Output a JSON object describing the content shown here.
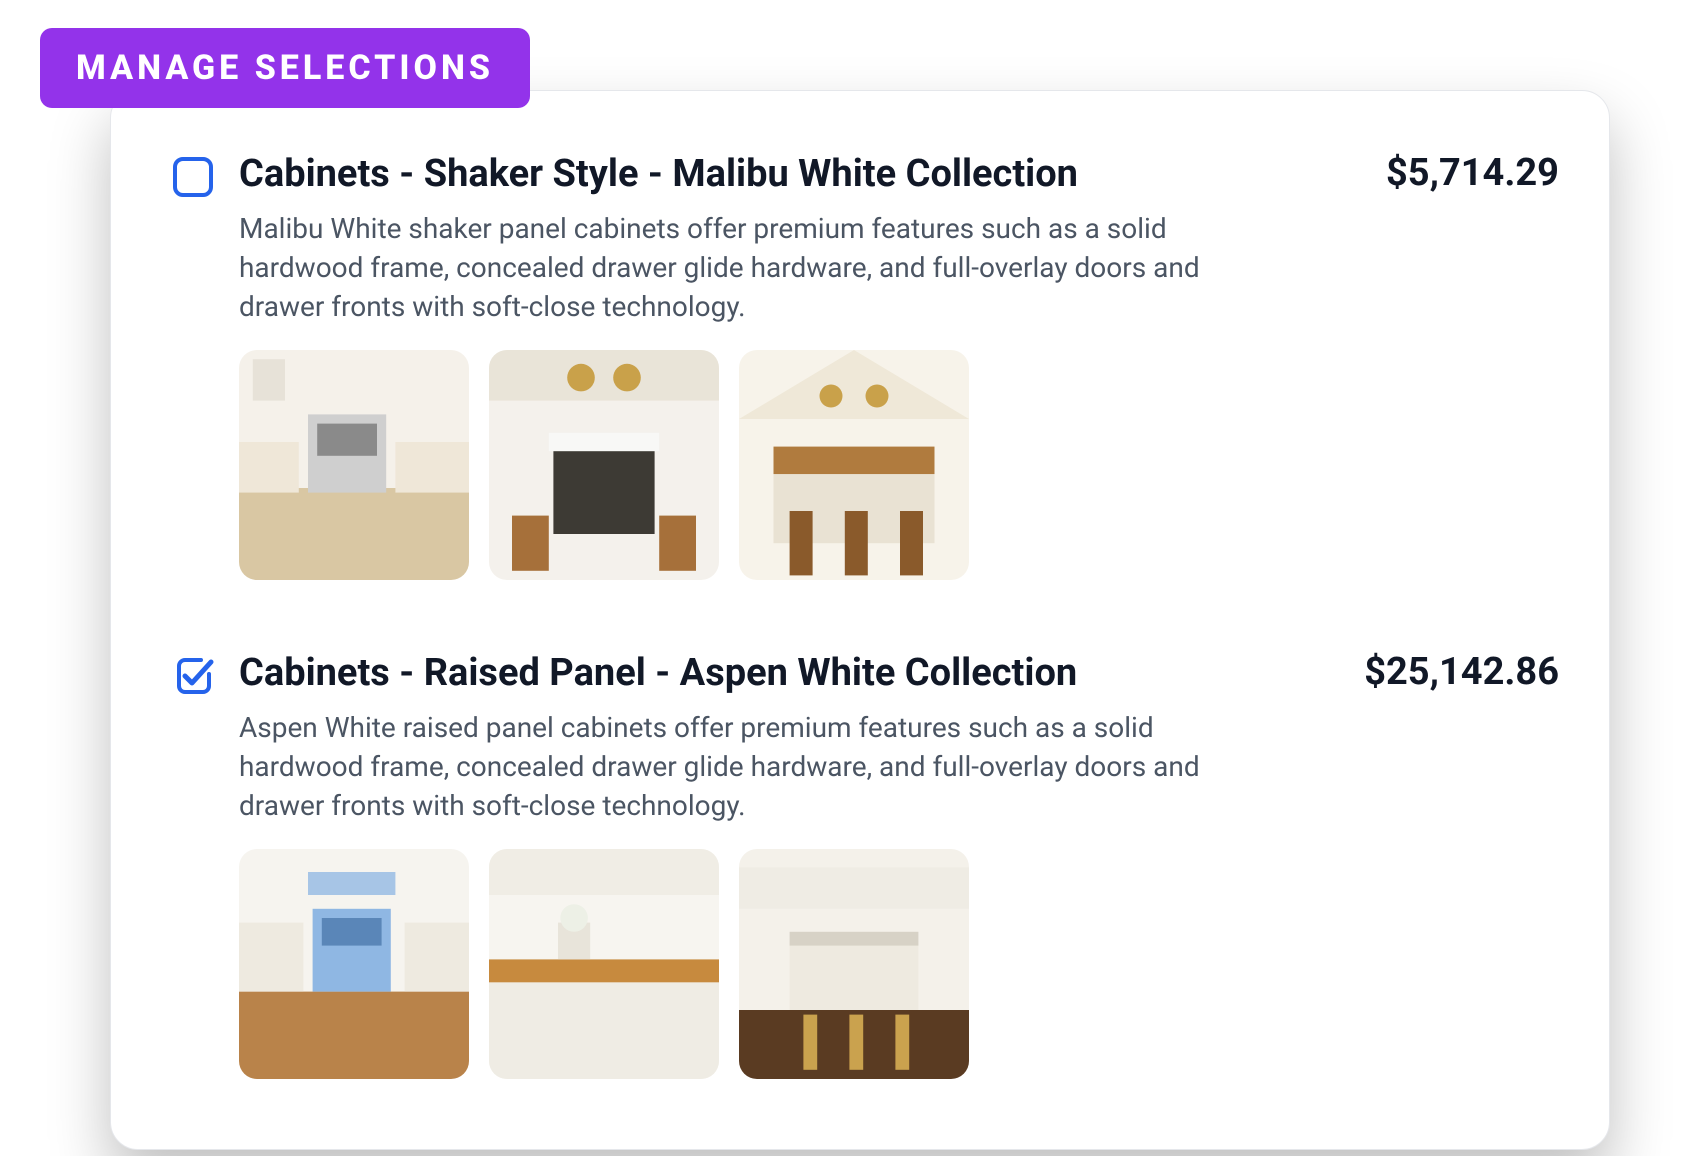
{
  "badge": "MANAGE SELECTIONS",
  "colors": {
    "accent_badge": "#9333ea",
    "checkbox_border": "#2563eb",
    "checkbox_check": "#2563eb",
    "text_primary": "#111827",
    "text_secondary": "#4b5563"
  },
  "items": [
    {
      "checked": false,
      "title": "Cabinets - Shaker Style - Malibu White Collection",
      "price": "$5,714.29",
      "description": "Malibu White shaker panel cabinets offer premium features such as a solid hardwood frame, concealed drawer glide hardware, and full-overlay doors and drawer fronts with soft-close technology.",
      "thumbs": [
        "kitchen-photo",
        "kitchen-photo",
        "kitchen-photo"
      ]
    },
    {
      "checked": true,
      "title": "Cabinets - Raised Panel - Aspen White Collection",
      "price": "$25,142.86",
      "description": "Aspen White raised panel cabinets offer premium features such as a solid hardwood frame, concealed drawer glide hardware, and full-overlay doors and drawer fronts with soft-close technology.",
      "thumbs": [
        "kitchen-photo",
        "kitchen-photo",
        "kitchen-photo"
      ]
    }
  ]
}
